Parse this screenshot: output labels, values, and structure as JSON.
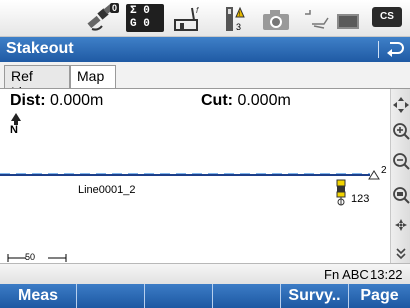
{
  "status_bar": {
    "icons": [
      "satellite-icon",
      "satellite-count-icon",
      "base-station-icon",
      "receiver-battery-icon",
      "camera-icon",
      "radio-link-icon",
      "memory-card-icon",
      "controller-settings-icon"
    ],
    "sat_line1": "Σ 0",
    "sat_line2": "G 0",
    "sat_badge": "0",
    "cs_label": "CS"
  },
  "title_bar": {
    "title": "Stakeout"
  },
  "tabs": [
    {
      "label": "Ref Line",
      "active": false
    },
    {
      "label": "Map",
      "active": true
    }
  ],
  "map": {
    "dist_label": "Dist:",
    "dist_value": "0.000m",
    "cut_label": "Cut:",
    "cut_value": "0.000m",
    "north_label": "N",
    "line_label": "Line0001_2",
    "point_label": "123",
    "end_label": "2",
    "scale_label": "50"
  },
  "right_toolbar": [
    "pan-icon",
    "zoom-in-icon",
    "zoom-out-icon",
    "zoom-fit-icon",
    "center-icon",
    "more-icon"
  ],
  "info_bar": {
    "fn": "Fn ABC",
    "time": "13:22"
  },
  "softkeys": [
    "Meas",
    "",
    "",
    "",
    "Survy..",
    "Page"
  ],
  "colors": {
    "accent": "#2a67b4",
    "line": "#1d3f8a",
    "dash": "#6aa9ea",
    "marker": "#f2d400"
  }
}
